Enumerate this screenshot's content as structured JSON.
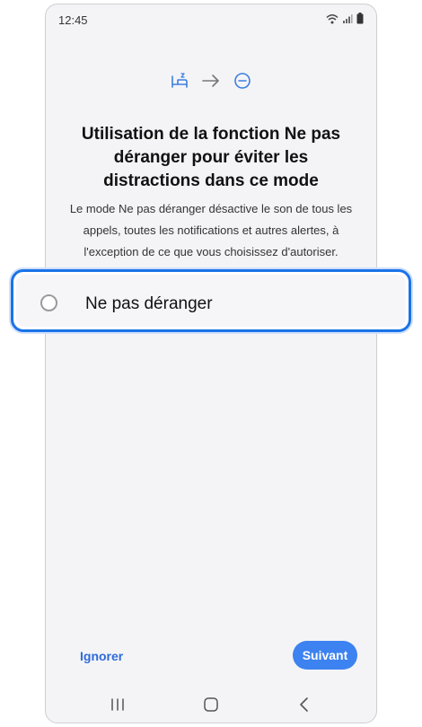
{
  "status_bar": {
    "time": "12:45",
    "icons": [
      "wifi-icon",
      "signal-icon",
      "battery-icon"
    ]
  },
  "flow": {
    "icons": [
      "bed-icon",
      "arrow-right-icon",
      "do-not-disturb-icon"
    ],
    "accent_color": "#3c7ee0"
  },
  "content": {
    "title": "Utilisation de la fonction Ne pas déranger pour éviter les distractions dans ce mode",
    "description": "Le mode Ne pas déranger désactive le son de tous les appels, toutes les notifications et autres alertes, à l'exception de ce que vous choisissez d'autoriser."
  },
  "option": {
    "label": "Ne pas déranger",
    "checked": false,
    "highlight_color": "#1a73e8"
  },
  "footer": {
    "ignore_label": "Ignorer",
    "next_label": "Suivant",
    "next_color": "#3c82f0"
  },
  "nav_bar": {
    "items": [
      "recents-icon",
      "home-icon",
      "back-icon"
    ]
  }
}
